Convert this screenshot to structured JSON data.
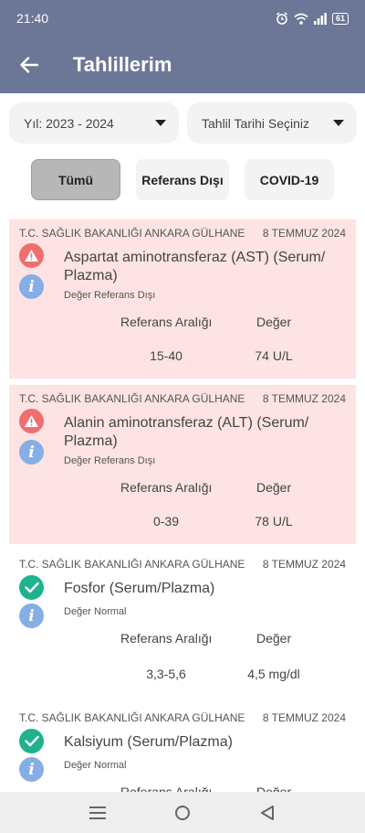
{
  "status_bar": {
    "time": "21:40",
    "battery": "61",
    "icons": [
      "alarm-icon",
      "wifi-icon",
      "signal-icon",
      "battery-icon"
    ]
  },
  "header": {
    "title": "Tahlillerim",
    "back_icon": "back-arrow-icon"
  },
  "filters": {
    "year_dropdown": "Yıl: 2023 - 2024",
    "date_dropdown": "Tahlil Tarihi Seçiniz",
    "chips": [
      "Tümü",
      "Referans Dışı",
      "COVID-19"
    ],
    "active_chip": "Tümü"
  },
  "table_headers": {
    "reference": "Referans Aralığı",
    "value": "Değer"
  },
  "results": [
    {
      "hospital": "T.C. SAĞLIK BAKANLIĞI ANKARA GÜLHANE",
      "date": "8 TEMMUZ 2024",
      "name": "Aspartat aminotransferaz (AST) (Serum/ Plazma)",
      "status": "Değer Referans Dışı",
      "abnormal": true,
      "reference_range": "15-40",
      "value": "74 U/L"
    },
    {
      "hospital": "T.C. SAĞLIK BAKANLIĞI ANKARA GÜLHANE",
      "date": "8 TEMMUZ 2024",
      "name": "Alanin aminotransferaz (ALT) (Serum/ Plazma)",
      "status": "Değer Referans Dışı",
      "abnormal": true,
      "reference_range": "0-39",
      "value": "78 U/L"
    },
    {
      "hospital": "T.C. SAĞLIK BAKANLIĞI ANKARA GÜLHANE",
      "date": "8 TEMMUZ 2024",
      "name": "Fosfor (Serum/Plazma)",
      "status": "Değer Normal",
      "abnormal": false,
      "reference_range": "3,3-5,6",
      "value": "4,5 mg/dl"
    },
    {
      "hospital": "T.C. SAĞLIK BAKANLIĞI ANKARA GÜLHANE",
      "date": "8 TEMMUZ 2024",
      "name": "Kalsiyum (Serum/Plazma)",
      "status": "Değer Normal",
      "abnormal": false,
      "reference_range": "",
      "value": ""
    }
  ],
  "colors": {
    "appbar": "#6c7798",
    "abnormal_bg": "#fde3e3",
    "warn": "#ef6f6f",
    "ok": "#1fb28c",
    "info": "#86aee6"
  }
}
